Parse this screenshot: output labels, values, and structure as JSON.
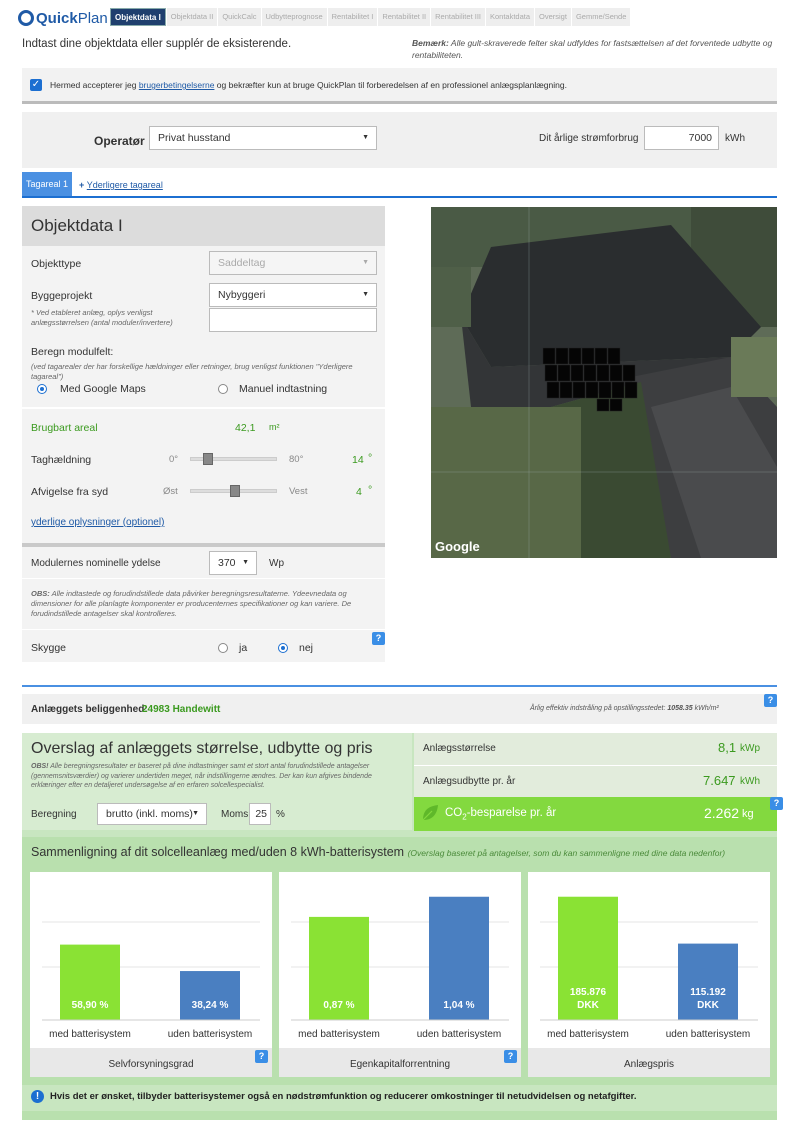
{
  "header": {
    "logo_text_bold": "Quick",
    "logo_text": "Plan",
    "steps": [
      "Objektdata I",
      "Objektdata II",
      "QuickCalc",
      "Udbytteprognose",
      "Rentabilitet I",
      "Rentabilitet II",
      "Rentabilitet III",
      "Kontaktdata",
      "Oversigt",
      "Gemme/Sende"
    ]
  },
  "intro": "Indtast dine objektdata eller supplér de eksisterende.",
  "note_label": "Bemærk:",
  "note": "Alle gult-skraverede felter skal udfyldes for fastsættelsen af det forventede udbytte og rentabiliteten.",
  "accept": {
    "before": "Hermed accepterer jeg ",
    "link": "brugerbetingelserne",
    "after": " og bekræfter kun at bruge QuickPlan til forberedelsen af en professionel anlægsplanlægning."
  },
  "operator": {
    "label": "Operatør",
    "value": "Privat husstand"
  },
  "consumption": {
    "label": "Dit årlige strømforbrug",
    "value": "7000",
    "unit": "kWh"
  },
  "tabs": {
    "active": "Tagareal 1",
    "add": "Yderligere tagareal"
  },
  "objekt": {
    "title": "Objektdata I",
    "objekttype_label": "Objekttype",
    "objekttype_value": "Saddeltag",
    "byggeprojekt_label": "Byggeprojekt",
    "byggeprojekt_value": "Nybyggeri",
    "byggeprojekt_hint": "* Ved etableret anlæg, oplys venligst anlægsstørrelsen (antal moduler/invertere)",
    "modulfelt_label": "Beregn modulfelt:",
    "modulfelt_hint": "(ved tagarealer der har forskellige hældninger eller retninger, brug venligst funktionen \"Yderligere tagareal\")",
    "option_google": "Med Google Maps",
    "option_manual": "Manuel indtastning",
    "area_label": "Brugbart areal",
    "area_value": "42,1",
    "area_unit": "m²",
    "tilt_label": "Taghældning",
    "tilt_min": "0°",
    "tilt_max": "80°",
    "tilt_value": "14",
    "tilt_fraction": 0.175,
    "deg": "°",
    "az_label": "Afvigelse fra syd",
    "az_min": "Øst",
    "az_max": "Vest",
    "az_value": "4",
    "az_fraction": 0.52,
    "more_link": "yderlige oplysninger (optionel)",
    "power_label": "Modulernes nominelle ydelse",
    "power_value": "370",
    "power_unit": "Wp",
    "obs_label": "OBS:",
    "obs": "Alle indtastede og forudindstillede data påvirker beregningsresultaterne. Ydeevnedata og dimensioner for alle planlagte komponenter er producenternes specifikationer og kan variere. De forudindstillede antagelser skal kontrolleres.",
    "shadow_label": "Skygge",
    "shadow_yes": "ja",
    "shadow_no": "nej"
  },
  "map": {
    "brand": "Google"
  },
  "location": {
    "label": "Anlæggets beliggenhed:",
    "value": "24983 Handewitt",
    "irradiance": "Årlig effektiv indstråling på opstillingsstedet:",
    "irradiance_value": "1058.35",
    "irradiance_unit": "kWh/m²"
  },
  "estimate": {
    "title": "Overslag af anlæggets størrelse, udbytte og pris",
    "obs_label": "OBS!",
    "obs": "Alle beregningsresultater er baseret på dine indtastninger samt et stort antal forudindstillede antagelser (gennemsnitsværdier) og varierer undertiden meget, når indstillingerne ændres. Der kan kun afgives bindende erklæringer efter en detaljeret undersøgelse af en erfaren solcellespecialist.",
    "calc_label": "Beregning",
    "calc_value": "brutto (inkl. moms)",
    "vat_label": "Moms",
    "vat_value": "25",
    "vat_unit": "%",
    "size_label": "Anlægsstørrelse",
    "size_value": "8,1",
    "size_unit": "kWp",
    "yield_label": "Anlægsudbytte pr. år",
    "yield_value": "7.647",
    "yield_unit": "kWh",
    "co2_prefix": "CO",
    "co2_sub": "2",
    "co2_label": "-besparelse pr. år",
    "co2_value": "2.262",
    "co2_unit": "kg"
  },
  "comparison": {
    "title": "Sammenligning af dit solcelleanlæg med/uden 8 kWh-batterisystem",
    "subtitle": "(Overslag baseret på antagelser, som du kan sammenligne med dine data nedenfor)"
  },
  "chart_data": [
    {
      "type": "bar",
      "title": "Selvforsyningsgrad",
      "categories": [
        "med batterisystem",
        "uden batterisystem"
      ],
      "values": [
        58.9,
        38.24
      ],
      "labels": [
        "58,90 %",
        "38,24 %"
      ],
      "colors": [
        "#8ae234",
        "#4a7fc1"
      ],
      "ylim": [
        0,
        100
      ]
    },
    {
      "type": "bar",
      "title": "Egenkapitalforrentning",
      "categories": [
        "med batterisystem",
        "uden batterisystem"
      ],
      "values": [
        0.87,
        1.04
      ],
      "labels": [
        "0,87 %",
        "1,04 %"
      ],
      "colors": [
        "#8ae234",
        "#4a7fc1"
      ],
      "ylim": [
        0,
        1.08
      ]
    },
    {
      "type": "bar",
      "title": "Anlægspris",
      "categories": [
        "med batterisystem",
        "uden batterisystem"
      ],
      "values": [
        185876,
        115192
      ],
      "labels": [
        "185.876 DKK",
        "115.192 DKK"
      ],
      "colors": [
        "#8ae234",
        "#4a7fc1"
      ],
      "ylim": [
        0,
        193000
      ]
    }
  ],
  "footer_info": "Hvis det er ønsket, tilbyder batterisystemer også en nødstrømfunktion og reducerer omkostninger til netudvidelsen og netafgifter.",
  "help": "?"
}
